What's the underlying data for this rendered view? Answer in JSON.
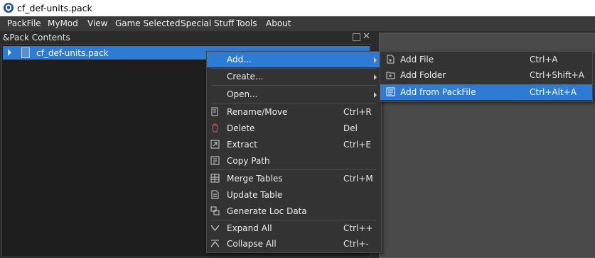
{
  "window": {
    "title": "cf_def-units.pack"
  },
  "menubar": [
    "PackFile",
    "MyMod",
    "View",
    "Game Selected",
    "Special Stuff",
    "Tools",
    "About"
  ],
  "dock": {
    "title": "&Pack Contents",
    "tree": {
      "root": "cf_def-units.pack"
    }
  },
  "context_menu": {
    "items": [
      {
        "label": "Add...",
        "shortcut": ""
      },
      {
        "label": "Create...",
        "shortcut": ""
      },
      {
        "label": "Open...",
        "shortcut": ""
      },
      {
        "label": "Rename/Move",
        "shortcut": "Ctrl+R"
      },
      {
        "label": "Delete",
        "shortcut": "Del"
      },
      {
        "label": "Extract",
        "shortcut": "Ctrl+E"
      },
      {
        "label": "Copy Path",
        "shortcut": ""
      },
      {
        "label": "Merge Tables",
        "shortcut": "Ctrl+M"
      },
      {
        "label": "Update Table",
        "shortcut": ""
      },
      {
        "label": "Generate Loc Data",
        "shortcut": ""
      },
      {
        "label": "Expand All",
        "shortcut": "Ctrl++"
      },
      {
        "label": "Collapse All",
        "shortcut": "Ctrl+-"
      }
    ]
  },
  "submenu": {
    "items": [
      {
        "label": "Add File",
        "shortcut": "Ctrl+A"
      },
      {
        "label": "Add Folder",
        "shortcut": "Ctrl+Shift+A"
      },
      {
        "label": "Add from PackFile",
        "shortcut": "Ctrl+Alt+A"
      }
    ]
  },
  "colors": {
    "accent": "#2e7bd6",
    "menu_bg": "#333333",
    "tree_bg": "#1e1e1e",
    "danger_icon": "#e05050"
  }
}
